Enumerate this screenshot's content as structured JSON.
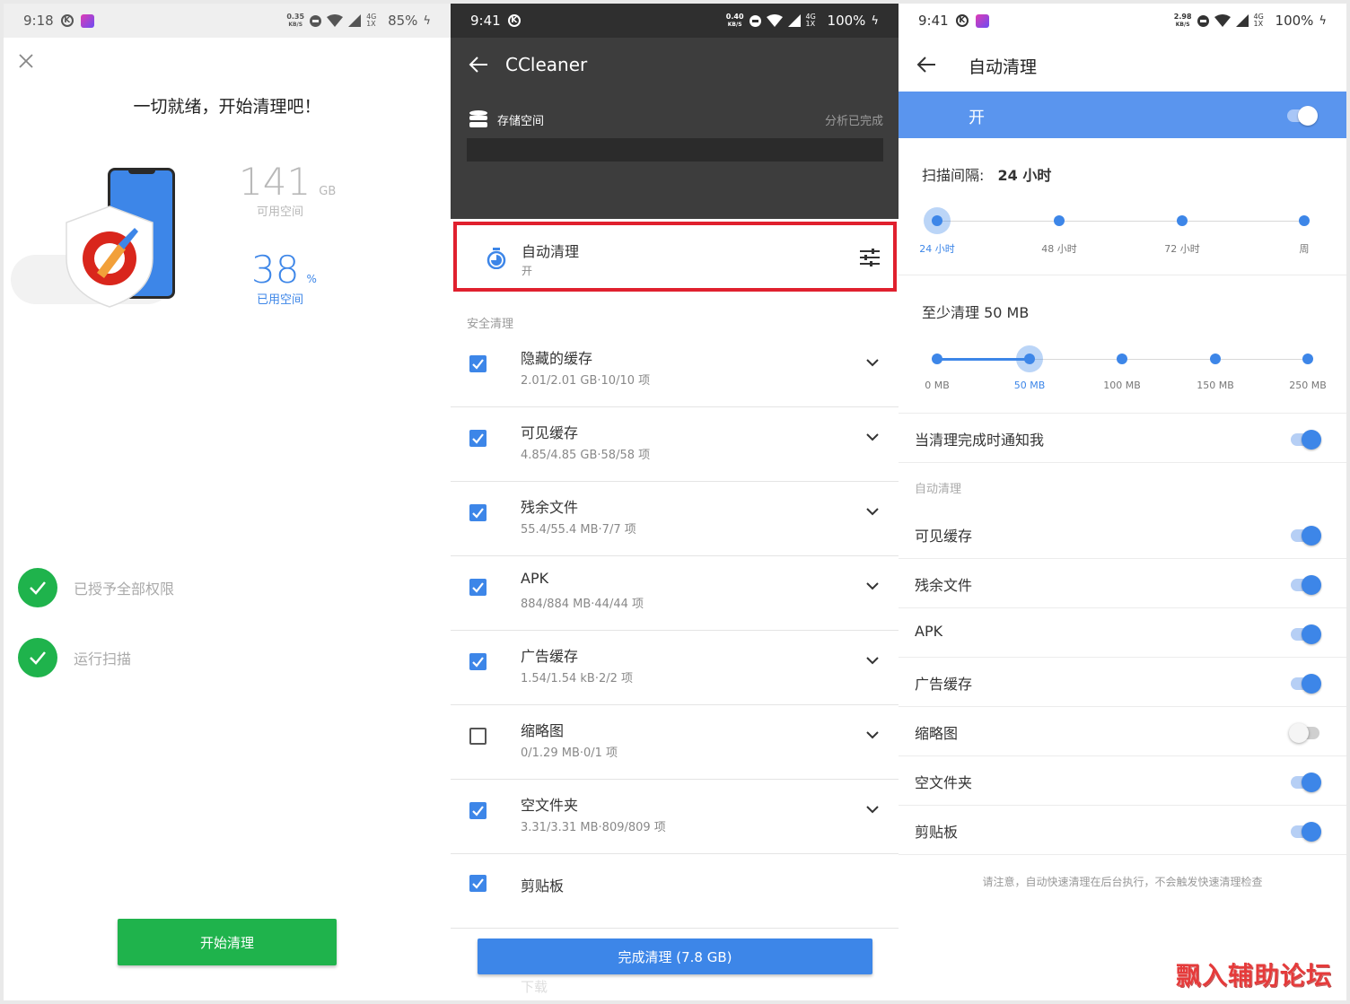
{
  "colors": {
    "green": "#1fb34c",
    "blue": "#3d86e8",
    "dark": "#3d3d3d",
    "red_highlight": "#e0202e"
  },
  "screen1": {
    "status": {
      "time": "9:18",
      "carrier_icon": "K",
      "speed_top": "0.35",
      "speed_unit": "KB/S",
      "network": "4G 1X",
      "battery": "85%"
    },
    "title": "一切就绪，开始清理吧！",
    "free_value": "141",
    "free_unit": "GB",
    "free_label": "可用空间",
    "used_value": "38",
    "used_unit": "%",
    "used_label": "已用空间",
    "steps": [
      {
        "label": "已授予全部权限"
      },
      {
        "label": "运行扫描"
      }
    ],
    "start_button": "开始清理"
  },
  "screen2": {
    "status": {
      "time": "9:41",
      "carrier_icon": "K",
      "speed_top": "0.40",
      "speed_unit": "KB/S",
      "network": "4G 1X",
      "battery": "100%"
    },
    "app_title": "CCleaner",
    "storage_label": "存储空间",
    "analysis_status": "分析已完成",
    "auto_clean": {
      "title": "自动清理",
      "subtitle": "开"
    },
    "section_label": "安全清理",
    "items": [
      {
        "title": "隐藏的缓存",
        "detail": "2.01/2.01 GB·10/10 项",
        "checked": true
      },
      {
        "title": "可见缓存",
        "detail": "4.85/4.85 GB·58/58 项",
        "checked": true
      },
      {
        "title": "残余文件",
        "detail": "55.4/55.4 MB·7/7 项",
        "checked": true
      },
      {
        "title": "APK",
        "detail": "884/884 MB·44/44 项",
        "checked": true
      },
      {
        "title": "广告缓存",
        "detail": "1.54/1.54 kB·2/2 项",
        "checked": true
      },
      {
        "title": "缩略图",
        "detail": "0/1.29 MB·0/1 项",
        "checked": false
      },
      {
        "title": "空文件夹",
        "detail": "3.31/3.31 MB·809/809 项",
        "checked": true
      },
      {
        "title": "剪贴板",
        "detail": "",
        "checked": true
      }
    ],
    "finish_button": "完成清理 (7.8 GB)",
    "hidden_row_label": "下载"
  },
  "screen3": {
    "status": {
      "time": "9:41",
      "carrier_icon": "K",
      "speed_top": "2.98",
      "speed_unit": "KB/S",
      "network": "4G 1X",
      "battery": "100%"
    },
    "title": "自动清理",
    "master_label": "开",
    "master_on": true,
    "interval_label": "扫描间隔:",
    "interval_value": "24 小时",
    "interval_options": [
      "24 小时",
      "48 小时",
      "72 小时",
      "周"
    ],
    "interval_selected_index": 0,
    "min_label": "至少清理 50 MB",
    "min_options": [
      "0 MB",
      "50 MB",
      "100 MB",
      "150 MB",
      "250 MB"
    ],
    "min_selected_index": 1,
    "notify_label": "当清理完成时通知我",
    "notify_on": true,
    "section_label": "自动清理",
    "toggles": [
      {
        "label": "可见缓存",
        "on": true
      },
      {
        "label": "残余文件",
        "on": true
      },
      {
        "label": "APK",
        "on": true
      },
      {
        "label": "广告缓存",
        "on": true
      },
      {
        "label": "缩略图",
        "on": false
      },
      {
        "label": "空文件夹",
        "on": true
      },
      {
        "label": "剪贴板",
        "on": true
      }
    ],
    "footnote": "请注意，自动快速清理在后台执行，不会触发快速清理检查"
  },
  "watermark": "飘入辅助论坛"
}
